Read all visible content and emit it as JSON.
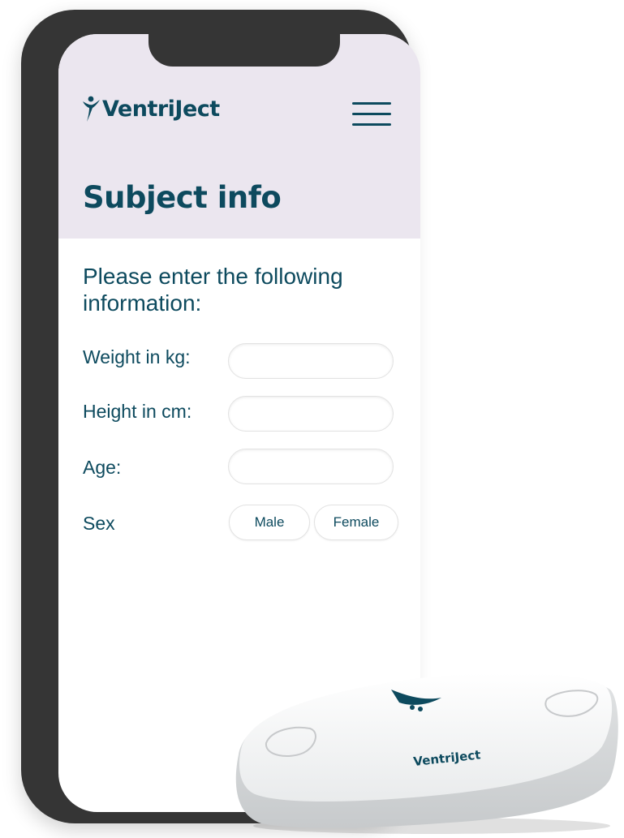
{
  "app": {
    "brand": "VentriJect"
  },
  "header": {
    "logo_text": "VentriJect",
    "menu_icon": "hamburger-menu-icon"
  },
  "page": {
    "title": "Subject info",
    "intro": "Please enter the following information:"
  },
  "form": {
    "weight": {
      "label": "Weight in kg:",
      "value": ""
    },
    "height": {
      "label": "Height in cm:",
      "value": ""
    },
    "age": {
      "label": "Age:",
      "value": ""
    },
    "sex": {
      "label": "Sex",
      "options": [
        "Male",
        "Female"
      ]
    }
  },
  "device": {
    "label": "VentriJect"
  },
  "colors": {
    "brand_teal": "#0d4a5e",
    "header_background": "#ebe6ef",
    "phone_frame": "#353535"
  }
}
